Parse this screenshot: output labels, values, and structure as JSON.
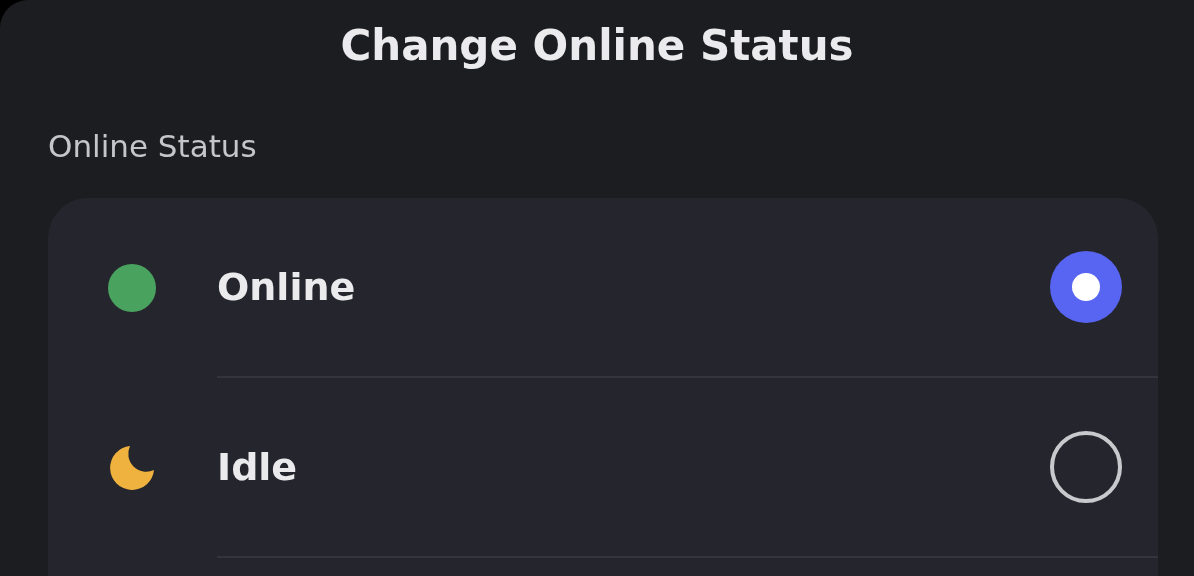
{
  "title": "Change Online Status",
  "section_label": "Online Status",
  "statuses": [
    {
      "label": "Online",
      "kind": "dot",
      "color": "#4aa25f",
      "selected": true
    },
    {
      "label": "Idle",
      "kind": "moon",
      "color": "#efb23e",
      "selected": false
    }
  ]
}
